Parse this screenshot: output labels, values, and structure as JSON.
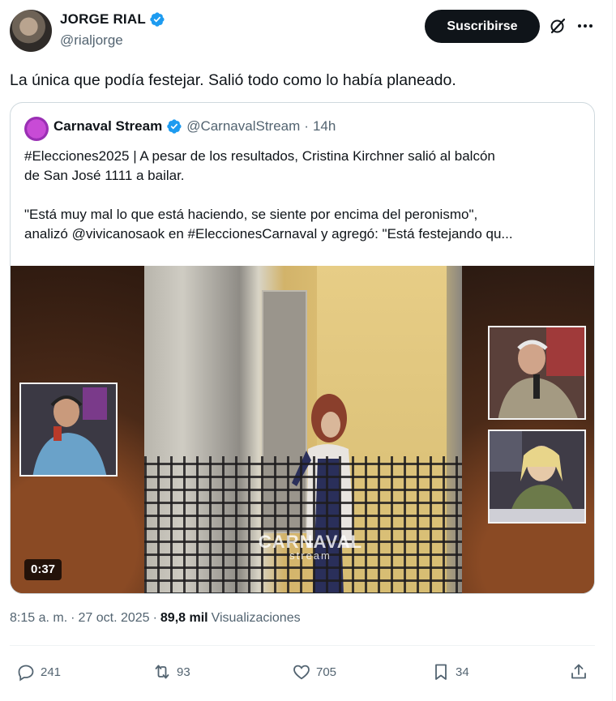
{
  "author": {
    "display_name": "JORGE RIAL",
    "handle": "@rialjorge",
    "verified": true
  },
  "header": {
    "subscribe_label": "Suscribirse",
    "grok_icon": "grok-icon",
    "more_icon": "more-horizontal-icon"
  },
  "tweet": {
    "text": "La única que podía festejar. Salió todo como lo había planeado."
  },
  "quoted": {
    "display_name": "Carnaval Stream",
    "handle": "@CarnavalStream",
    "separator": "·",
    "time": "14h",
    "verified": true,
    "lines": [
      "#Elecciones2025 | A pesar de los resultados, Cristina Kirchner salió al balcón",
      "de San José 1111 a bailar.",
      "\"Está muy mal lo que está haciendo, se siente por encima del peronismo\",",
      "analizó @vivicanosaok en #EleccionesCarnaval y agregó: \"Está festejando qu..."
    ],
    "video": {
      "duration": "0:37",
      "watermark_top": "CARNAVAL",
      "watermark_bottom": "stream"
    }
  },
  "meta": {
    "time": "8:15 a. m.",
    "separator": "·",
    "date": "27 oct. 2025",
    "views_count": "89,8 mil",
    "views_label": "Visualizaciones"
  },
  "actions": {
    "replies": "241",
    "reposts": "93",
    "likes": "705",
    "bookmarks": "34"
  },
  "colors": {
    "text_primary": "#0f1419",
    "text_secondary": "#536471",
    "verified_blue": "#1d9bf0",
    "button_bg": "#0f1419"
  }
}
